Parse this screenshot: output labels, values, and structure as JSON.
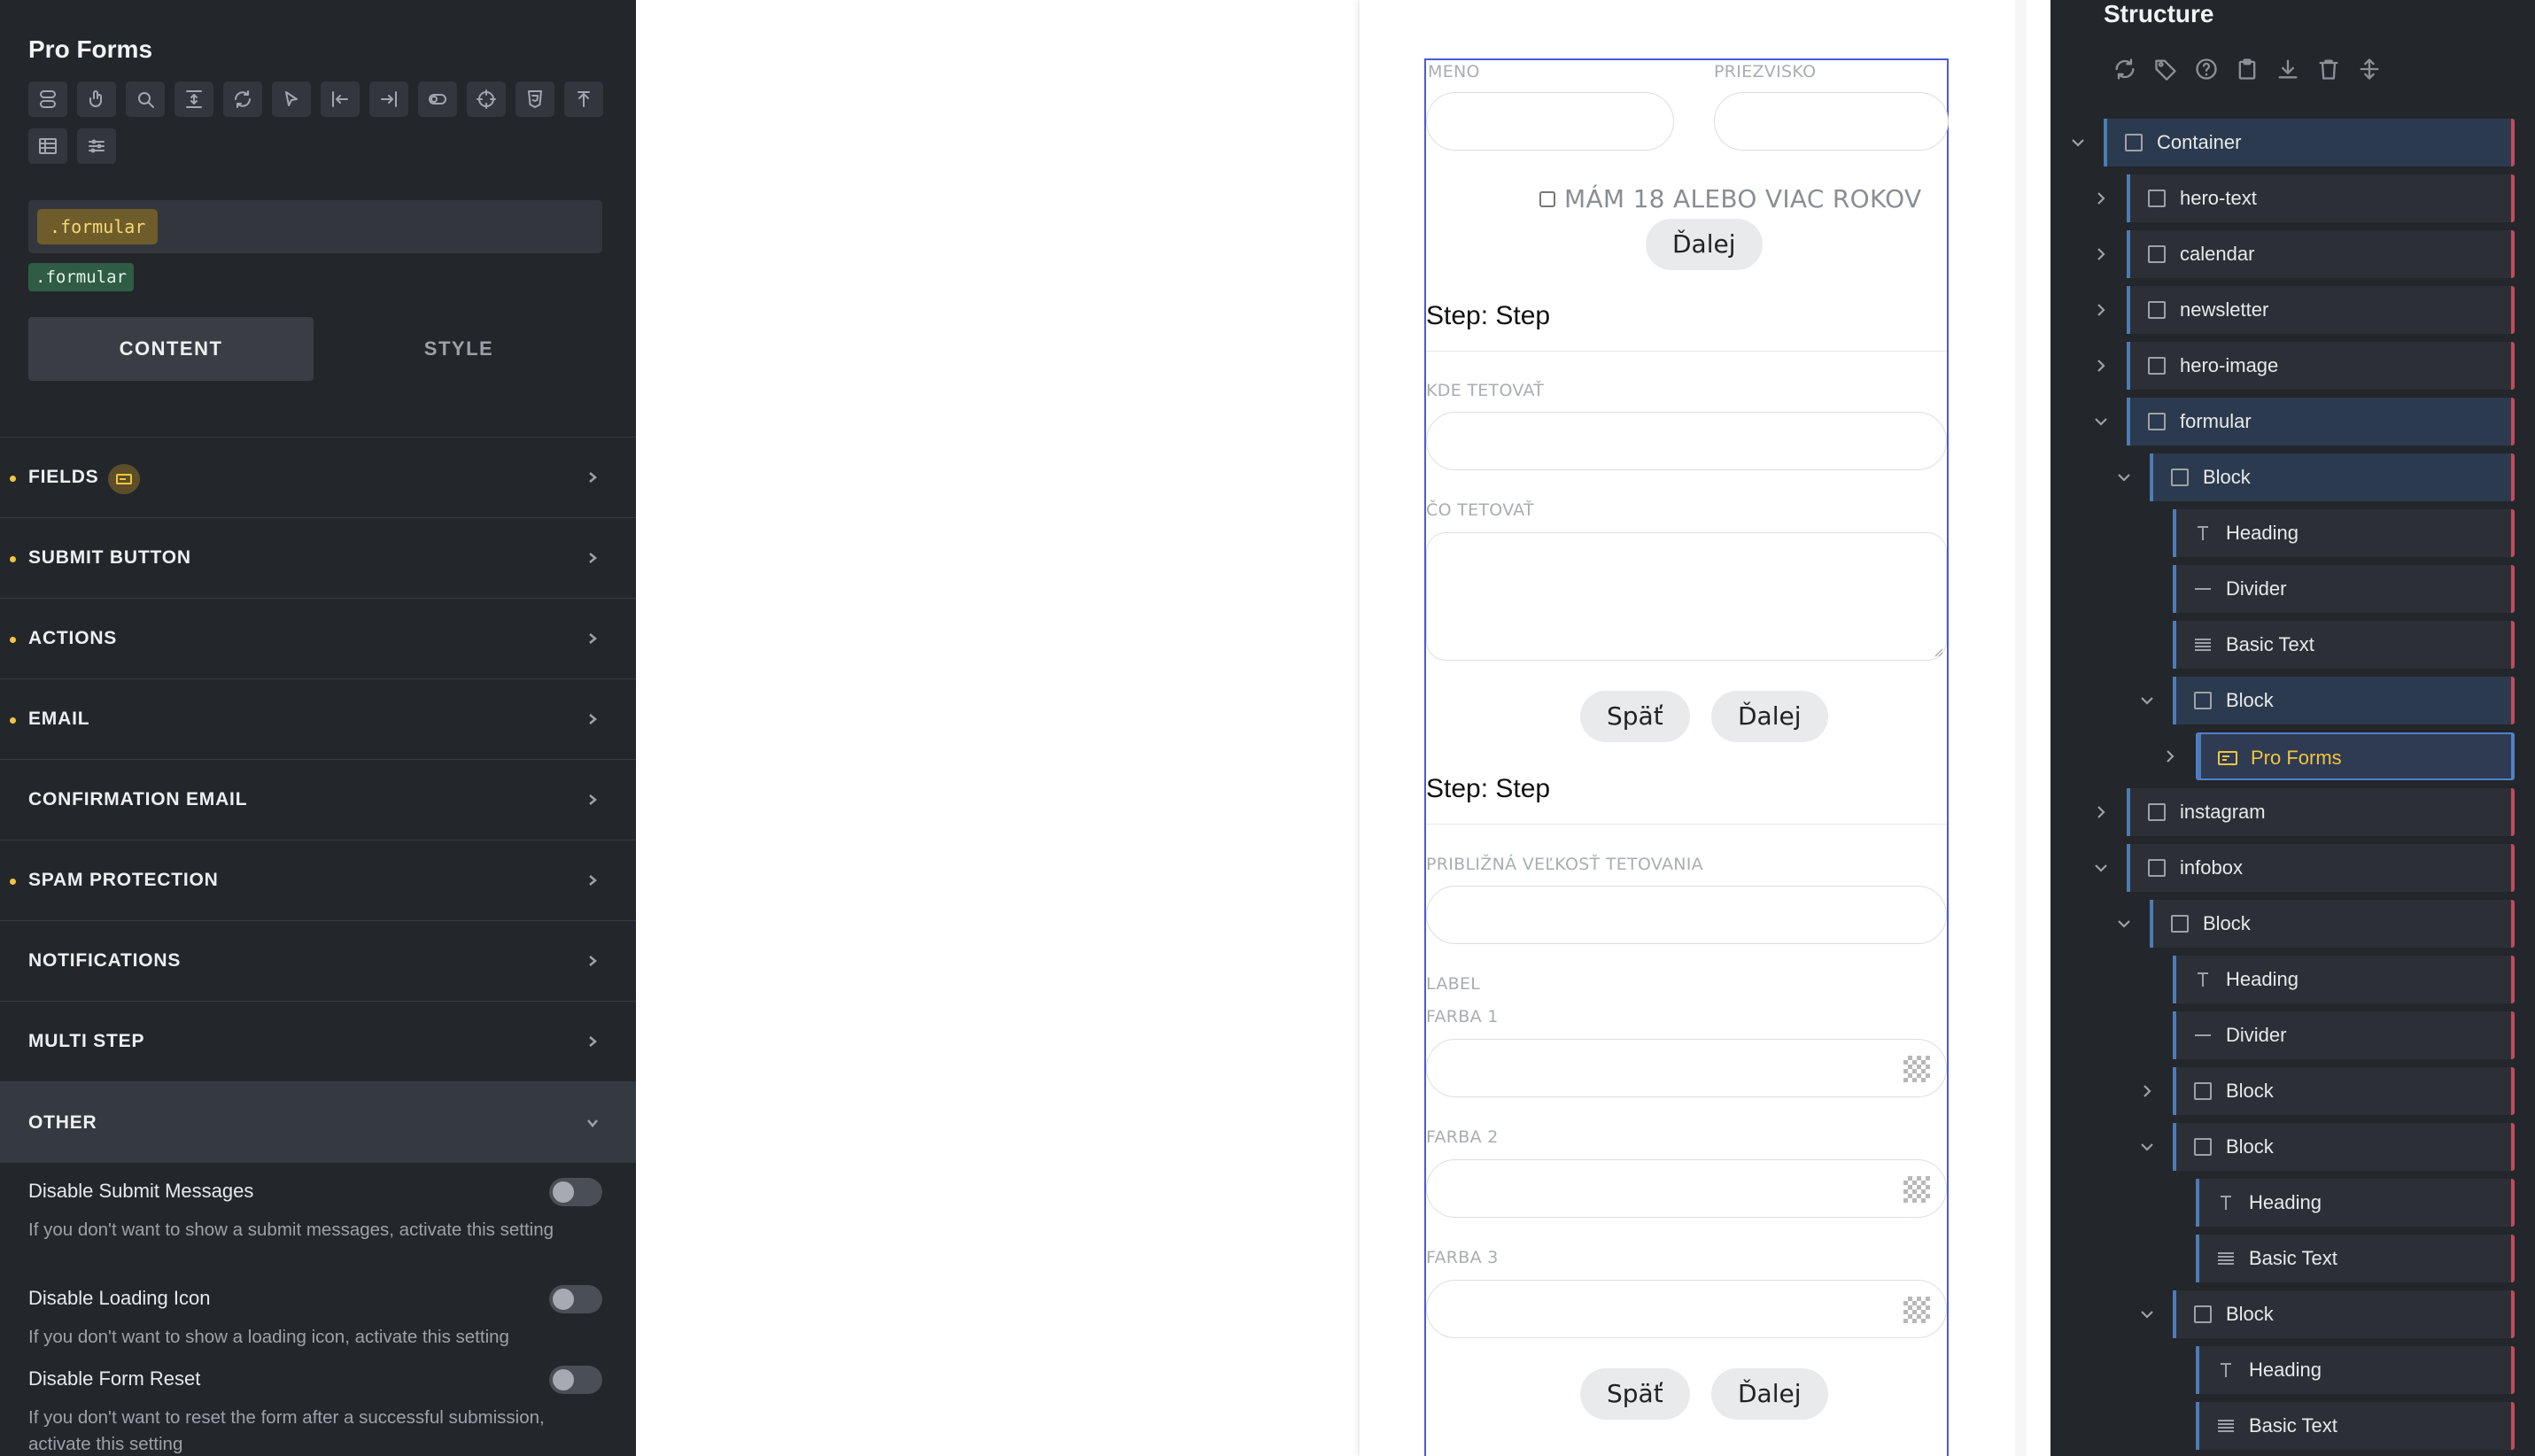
{
  "left_panel": {
    "title": "Pro Forms",
    "toolbar_icons": [
      "toggle-icon",
      "hand-icon",
      "search-icon",
      "align-vertical-icon",
      "refresh-icon",
      "cursor-icon",
      "align-left-icon",
      "align-right-icon",
      "switch-icon",
      "crosshair-icon",
      "css-icon",
      "upload-icon",
      "table-icon",
      "sliders-icon"
    ],
    "class_chip": ".formular",
    "class_tag": ".formular",
    "tabs": {
      "content": "CONTENT",
      "style": "STYLE"
    },
    "sections": [
      {
        "label": "FIELDS",
        "dot": true,
        "badge": true
      },
      {
        "label": "SUBMIT BUTTON",
        "dot": true
      },
      {
        "label": "ACTIONS",
        "dot": true
      },
      {
        "label": "EMAIL",
        "dot": true
      },
      {
        "label": "CONFIRMATION EMAIL",
        "dot": false
      },
      {
        "label": "SPAM PROTECTION",
        "dot": true
      },
      {
        "label": "NOTIFICATIONS",
        "dot": false
      },
      {
        "label": "MULTI STEP",
        "dot": false
      },
      {
        "label": "OTHER",
        "dot": false,
        "open": true
      }
    ],
    "settings": [
      {
        "label": "Disable Submit Messages",
        "desc": "If you don't want to show a submit messages, activate this setting",
        "on": false
      },
      {
        "label": "Disable Loading Icon",
        "desc": "If you don't want to show a loading icon, activate this setting",
        "on": false
      },
      {
        "label": "Disable Form Reset",
        "desc": "If you don't want to reset the form after a successful submission, activate this setting",
        "on": false
      }
    ]
  },
  "form": {
    "first_name_label": "MENO",
    "last_name_label": "PRIEZVISKO",
    "age_checkbox": "MÁM 18 ALEBO VIAC ROKOV",
    "next": "Ďalej",
    "back": "Späť",
    "step1_heading": "Step: Step",
    "where_label": "KDE TETOVAŤ",
    "what_label": "ČO TETOVAŤ",
    "step2_heading": "Step: Step",
    "size_label": "PRIBLIŽNÁ VEĽKOSŤ TETOVANIA",
    "generic_label": "LABEL",
    "color1_label": "FARBA 1",
    "color2_label": "FARBA 2",
    "color3_label": "FARBA 3"
  },
  "structure": {
    "title": "Structure",
    "tools": [
      "refresh-icon",
      "tag-icon",
      "help-icon",
      "clipboard-icon",
      "download-icon",
      "trash-icon",
      "expand-icon"
    ],
    "items": [
      {
        "name": "Container",
        "depth": 0,
        "caret": "down",
        "icon": "block",
        "hi": true
      },
      {
        "name": "hero-text",
        "depth": 1,
        "caret": "right",
        "icon": "block"
      },
      {
        "name": "calendar",
        "depth": 1,
        "caret": "right",
        "icon": "block"
      },
      {
        "name": "newsletter",
        "depth": 1,
        "caret": "right",
        "icon": "block"
      },
      {
        "name": "hero-image",
        "depth": 1,
        "caret": "right",
        "icon": "block"
      },
      {
        "name": "formular",
        "depth": 1,
        "caret": "down",
        "icon": "block",
        "hi": true
      },
      {
        "name": "Block",
        "depth": 2,
        "caret": "down",
        "icon": "block",
        "hi": true
      },
      {
        "name": "Heading",
        "depth": 3,
        "caret": "",
        "icon": "heading"
      },
      {
        "name": "Divider",
        "depth": 3,
        "caret": "",
        "icon": "divider"
      },
      {
        "name": "Basic Text",
        "depth": 3,
        "caret": "",
        "icon": "text"
      },
      {
        "name": "Block",
        "depth": 3,
        "caret": "down",
        "icon": "block",
        "hi": true
      },
      {
        "name": "Pro Forms",
        "depth": 4,
        "caret": "right",
        "icon": "form",
        "sel": true
      },
      {
        "name": "instagram",
        "depth": 1,
        "caret": "right",
        "icon": "block"
      },
      {
        "name": "infobox",
        "depth": 1,
        "caret": "down",
        "icon": "block"
      },
      {
        "name": "Block",
        "depth": 2,
        "caret": "down",
        "icon": "block"
      },
      {
        "name": "Heading",
        "depth": 3,
        "caret": "",
        "icon": "heading"
      },
      {
        "name": "Divider",
        "depth": 3,
        "caret": "",
        "icon": "divider"
      },
      {
        "name": "Block",
        "depth": 3,
        "caret": "right",
        "icon": "block"
      },
      {
        "name": "Block",
        "depth": 3,
        "caret": "down",
        "icon": "block"
      },
      {
        "name": "Heading",
        "depth": 4,
        "caret": "",
        "icon": "heading"
      },
      {
        "name": "Basic Text",
        "depth": 4,
        "caret": "",
        "icon": "text"
      },
      {
        "name": "Block",
        "depth": 3,
        "caret": "down",
        "icon": "block"
      },
      {
        "name": "Heading",
        "depth": 4,
        "caret": "",
        "icon": "heading"
      },
      {
        "name": "Basic Text",
        "depth": 4,
        "caret": "",
        "icon": "text"
      }
    ]
  }
}
